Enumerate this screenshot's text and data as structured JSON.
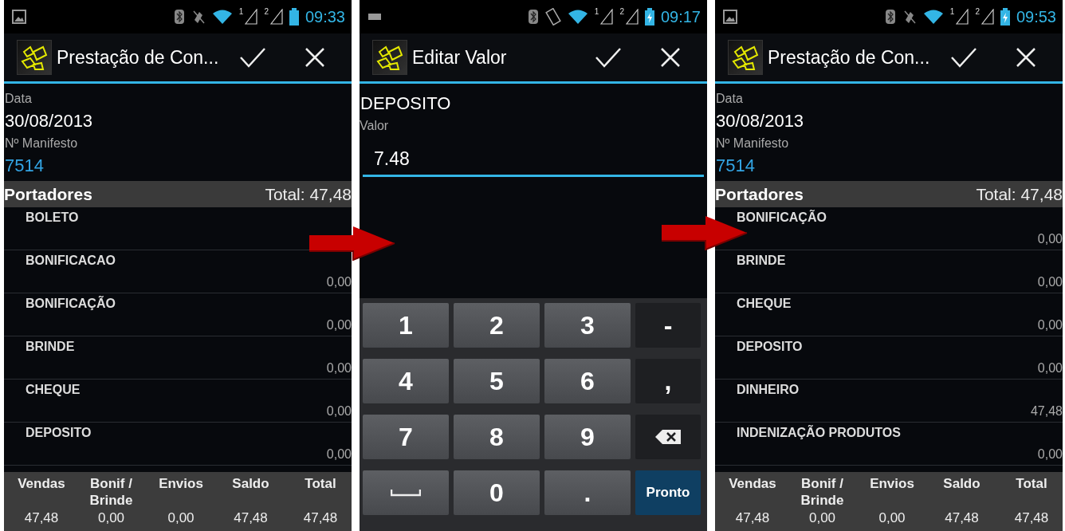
{
  "screens": [
    {
      "kind": "list",
      "status_bar": {
        "time": "09:33",
        "sim_labels": [
          "1",
          "2"
        ],
        "charging": false
      },
      "action_bar": {
        "title": "Prestação de Con..."
      },
      "fields": [
        {
          "label": "Data",
          "value": "30/08/2013",
          "link": false
        },
        {
          "label": "Nº Manifesto",
          "value": "7514",
          "link": true
        }
      ],
      "section": {
        "title": "Portadores",
        "total": "Total: 47,48"
      },
      "rows": [
        {
          "name": "BOLETO"
        },
        {
          "name": "BONIFICACAO",
          "value": "0,00"
        },
        {
          "name": "BONIFICAÇÃO",
          "value": "0,00"
        },
        {
          "name": "BRINDE",
          "value": "0,00"
        },
        {
          "name": "CHEQUE",
          "value": "0,00"
        },
        {
          "name": "DEPOSITO",
          "value": "0,00"
        }
      ],
      "footer": [
        {
          "label": "Vendas",
          "value": "47,48"
        },
        {
          "label": "Bonif / Brinde",
          "value": "0,00"
        },
        {
          "label": "Envios",
          "value": "0,00"
        },
        {
          "label": "Saldo",
          "value": "47,48"
        },
        {
          "label": "Total",
          "value": "47,48"
        }
      ]
    },
    {
      "kind": "editor",
      "status_bar": {
        "time": "09:17",
        "sim_labels": [
          "1",
          "2"
        ],
        "charging": true
      },
      "action_bar": {
        "title": "Editar Valor"
      },
      "heading": "DEPOSITO",
      "field": {
        "label": "Valor",
        "value": "7.48"
      },
      "keys": [
        {
          "kind": "digit",
          "label": "1"
        },
        {
          "kind": "digit",
          "label": "2"
        },
        {
          "kind": "digit",
          "label": "3"
        },
        {
          "kind": "symbol",
          "label": "-"
        },
        {
          "kind": "digit",
          "label": "4"
        },
        {
          "kind": "digit",
          "label": "5"
        },
        {
          "kind": "digit",
          "label": "6"
        },
        {
          "kind": "symbol",
          "label": ","
        },
        {
          "kind": "digit",
          "label": "7"
        },
        {
          "kind": "digit",
          "label": "8"
        },
        {
          "kind": "digit",
          "label": "9"
        },
        {
          "kind": "backspace"
        },
        {
          "kind": "space"
        },
        {
          "kind": "digit",
          "label": "0"
        },
        {
          "kind": "digit",
          "label": "."
        },
        {
          "kind": "done",
          "label": "Pronto"
        }
      ]
    },
    {
      "kind": "list",
      "status_bar": {
        "time": "09:53",
        "sim_labels": [
          "1",
          "2"
        ],
        "charging": true
      },
      "action_bar": {
        "title": "Prestação de Con..."
      },
      "fields": [
        {
          "label": "Data",
          "value": "30/08/2013",
          "link": false
        },
        {
          "label": "Nº Manifesto",
          "value": "7514",
          "link": true
        }
      ],
      "section": {
        "title": "Portadores",
        "total": "Total: 47,48"
      },
      "rows": [
        {
          "name": "BONIFICAÇÃO",
          "value": "0,00"
        },
        {
          "name": "BRINDE",
          "value": "0,00"
        },
        {
          "name": "CHEQUE",
          "value": "0,00"
        },
        {
          "name": "DEPOSITO",
          "value": "0,00"
        },
        {
          "name": "DINHEIRO",
          "value": "47,48"
        },
        {
          "name": "INDENIZAÇÃO PRODUTOS",
          "value": "0,00"
        }
      ],
      "footer": [
        {
          "label": "Vendas",
          "value": "47,48"
        },
        {
          "label": "Bonif / Brinde",
          "value": "0,00"
        },
        {
          "label": "Envios",
          "value": "0,00"
        },
        {
          "label": "Saldo",
          "value": "47,48"
        },
        {
          "label": "Total",
          "value": "47,48"
        }
      ]
    }
  ]
}
